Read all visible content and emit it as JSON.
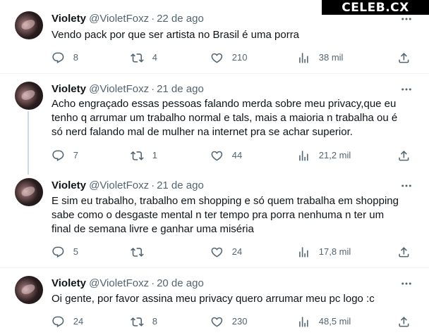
{
  "watermark": "CELEB.CX",
  "colors": {
    "secondary_text": "#536471",
    "divider": "#eff3f4",
    "thread_line": "#cfd9de"
  },
  "tweets": [
    {
      "name": "Violety",
      "handle": "@VioletFoxz",
      "separator": "·",
      "date": "22 de ago",
      "text": "Vendo pack por que ser artista no Brasil é uma porra",
      "replies": "8",
      "retweets": "4",
      "likes": "210",
      "views": "38 mil"
    },
    {
      "name": "Violety",
      "handle": "@VioletFoxz",
      "separator": "·",
      "date": "21 de ago",
      "text": "Acho engraçado essas  pessoas falando merda sobre meu privacy,que eu\ntenho q arrumar um trabalho  normal e tals, mais a maioria n trabalha ou é\nsó nerd falando mal de mulher na internet pra se achar superior.",
      "replies": "7",
      "retweets": "1",
      "likes": "44",
      "views": "21,2 mil"
    },
    {
      "name": "Violety",
      "handle": "@VioletFoxz",
      "separator": "·",
      "date": "21 de ago",
      "text": "E sim eu trabalho, trabalho em shopping e só quem trabalha em shopping\nsabe como o desgaste mental n ter tempo pra porra nenhuma n ter um\nfinal de semana livre e ganhar uma miséria",
      "replies": "5",
      "retweets": "",
      "likes": "24",
      "views": "17,8 mil"
    },
    {
      "name": "Violety",
      "handle": "@VioletFoxz",
      "separator": "·",
      "date": "20 de ago",
      "text": "Oi gente, por favor assina meu privacy quero arrumar meu pc logo :c",
      "replies": "24",
      "retweets": "8",
      "likes": "230",
      "views": "48,5 mil"
    }
  ]
}
